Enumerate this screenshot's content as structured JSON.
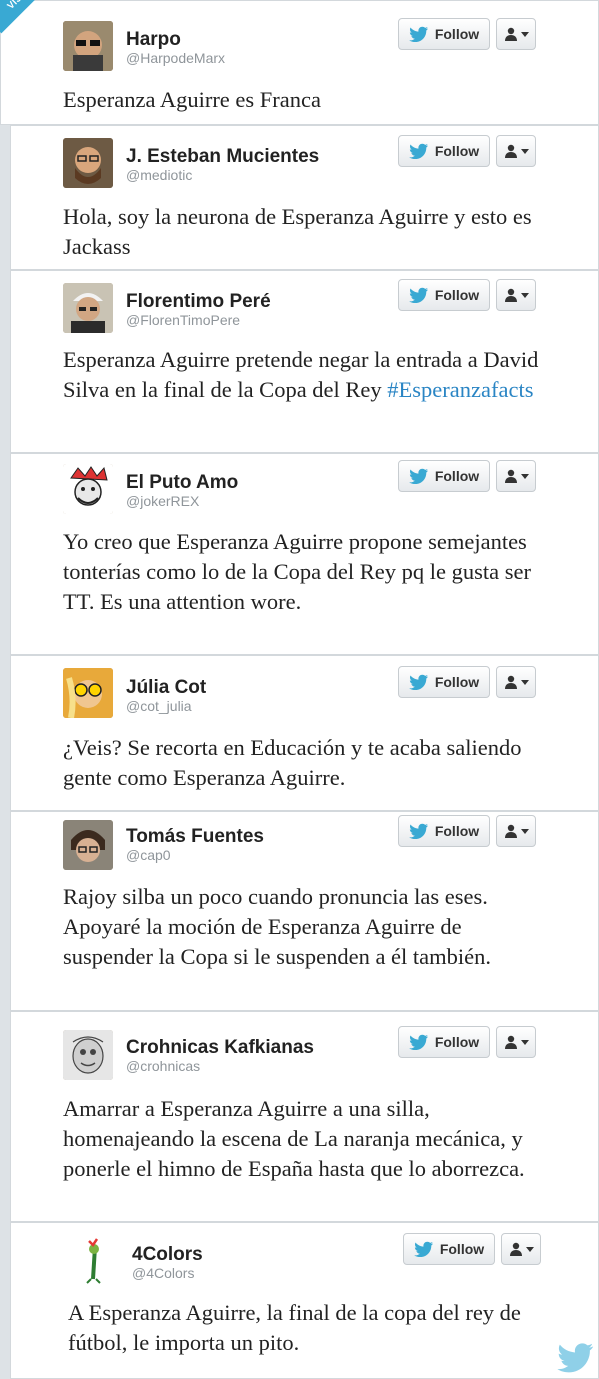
{
  "watermark": "VISTOENFB.COM",
  "follow_label": "Follow",
  "colors": {
    "link": "#2a85c4",
    "twitter_blue": "#39a9d3",
    "background": "#dde2e6"
  },
  "tweets": [
    {
      "name": "Harpo",
      "handle": "@HarpodeMarx",
      "text": "Esperanza Aguirre es Franca"
    },
    {
      "name": "J. Esteban Mucientes",
      "handle": "@mediotic",
      "text": "Hola, soy la neurona de Esperanza Aguirre y esto es Jackass"
    },
    {
      "name": "Florentimo Peré",
      "handle": "@FlorenTimoPere",
      "text": "Esperanza Aguirre pretende negar la entrada a David Silva en la final de la Copa del Rey",
      "hashtag": "#Esperanzafacts"
    },
    {
      "name": "El Puto Amo",
      "handle": "@jokerREX",
      "text": "Yo creo que Esperanza Aguirre propone semejantes tonterías como lo de la Copa del Rey pq le gusta ser TT. Es una attention wore."
    },
    {
      "name": "Júlia Cot",
      "handle": "@cot_julia",
      "text": "¿Veis? Se recorta en Educación y te acaba saliendo gente como Esperanza Aguirre."
    },
    {
      "name": "Tomás Fuentes",
      "handle": "@cap0",
      "text": "Rajoy silba un poco cuando pronuncia las eses. Apoyaré la moción de Esperanza Aguirre de suspender la Copa si le suspenden a él también."
    },
    {
      "name": "Crohnicas Kafkianas",
      "handle": "@crohnicas",
      "text": "Amarrar a Esperanza Aguirre a una silla, homenajeando la escena de La naranja mecánica, y ponerle el himno de España hasta que lo aborrezca."
    },
    {
      "name": "4Colors",
      "handle": "@4Colors",
      "text": "A Esperanza Aguirre, la final de la copa del rey de fútbol, le importa un pito."
    }
  ]
}
